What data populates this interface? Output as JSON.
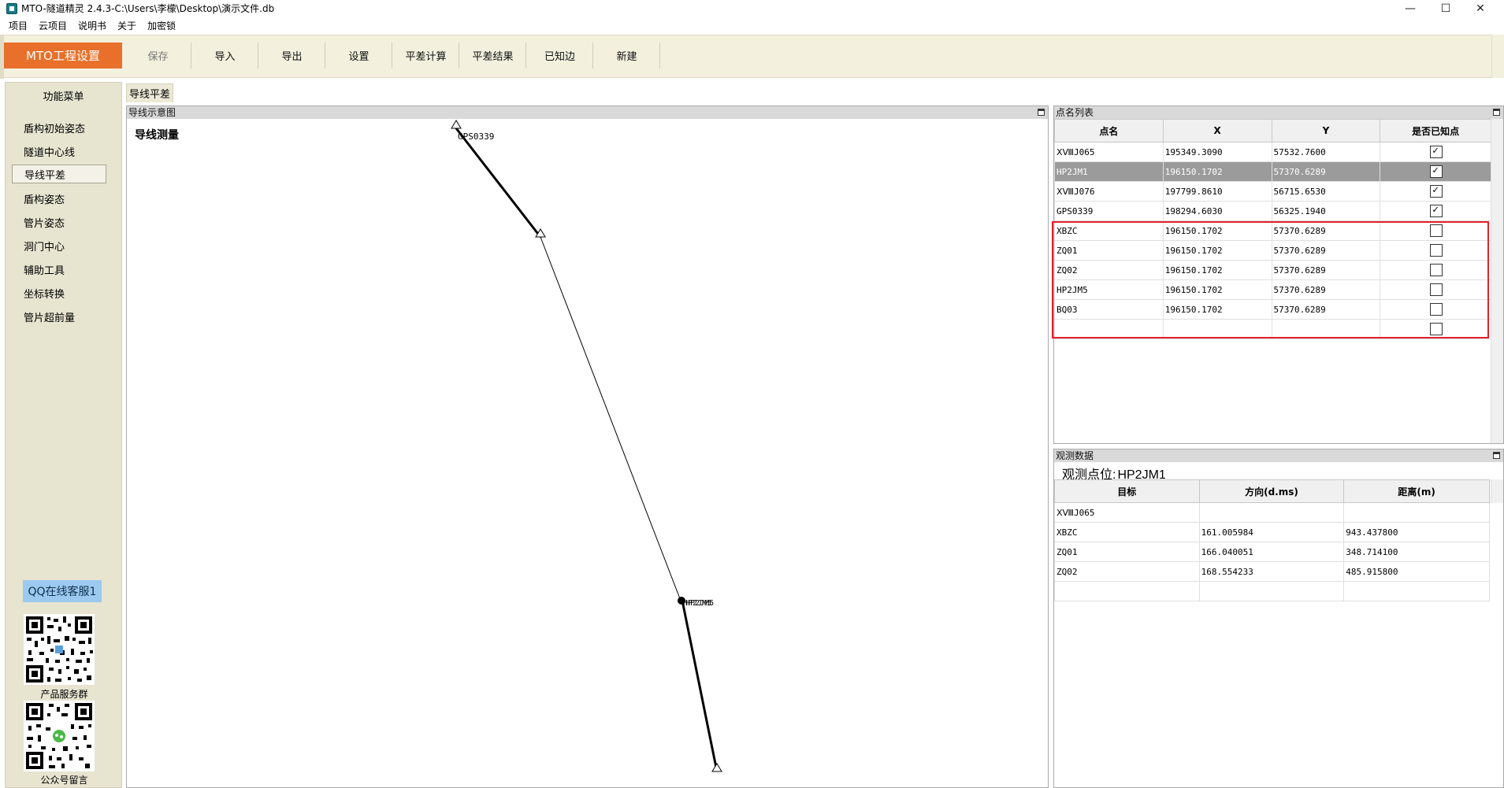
{
  "window": {
    "title": "MTO-隧道精灵 2.4.3-C:\\Users\\李檬\\Desktop\\演示文件.db",
    "min": "—",
    "max": "☐",
    "close": "✕"
  },
  "menu": [
    "项目",
    "云项目",
    "说明书",
    "关于",
    "加密锁"
  ],
  "toolbar": {
    "project_settings": "MTO工程设置",
    "buttons": [
      "保存",
      "导入",
      "导出",
      "设置",
      "平差计算",
      "平差结果",
      "已知边",
      "新建"
    ]
  },
  "sidebar": {
    "title": "功能菜单",
    "items": [
      "盾构初始姿态",
      "隧道中心线",
      "导线平差",
      "盾构姿态",
      "管片姿态",
      "洞门中心",
      "辅助工具",
      "坐标转换",
      "管片超前量"
    ],
    "active_index": 2,
    "qq_service": "QQ在线客服1",
    "qr1_label": "产品服务群",
    "qr2_label": "公众号留言"
  },
  "main_tab": "导线平差",
  "diagram": {
    "panel_title": "导线示意图",
    "heading": "导线测量",
    "point_label_top": "GPS0339",
    "point_label_cluster": "HP2JM5"
  },
  "point_list": {
    "panel_title": "点名列表",
    "columns": [
      "点名",
      "X",
      "Y",
      "是否已知点"
    ],
    "rows": [
      {
        "name": "ⅩⅧJ065",
        "x": "195349.3090",
        "y": "57532.7600",
        "known": true
      },
      {
        "name": "HP2JM1",
        "x": "196150.1702",
        "y": "57370.6289",
        "known": true
      },
      {
        "name": "ⅩⅧJ076",
        "x": "197799.8610",
        "y": "56715.6530",
        "known": true
      },
      {
        "name": "GPS0339",
        "x": "198294.6030",
        "y": "56325.1940",
        "known": true
      },
      {
        "name": "XBZC",
        "x": "196150.1702",
        "y": "57370.6289",
        "known": false
      },
      {
        "name": "ZQ01",
        "x": "196150.1702",
        "y": "57370.6289",
        "known": false
      },
      {
        "name": "ZQ02",
        "x": "196150.1702",
        "y": "57370.6289",
        "known": false
      },
      {
        "name": "HP2JM5",
        "x": "196150.1702",
        "y": "57370.6289",
        "known": false
      },
      {
        "name": "BQ03",
        "x": "196150.1702",
        "y": "57370.6289",
        "known": false
      },
      {
        "name": "",
        "x": "",
        "y": "",
        "known": false
      }
    ],
    "selected_index": 1
  },
  "observation": {
    "panel_title": "观测数据",
    "station_label": "观测点位:",
    "station_value": "HP2JM1",
    "columns": [
      "目标",
      "方向(d.ms)",
      "距离(m)"
    ],
    "rows": [
      {
        "target": "ⅩⅧJ065",
        "direction": "",
        "distance": ""
      },
      {
        "target": "XBZC",
        "direction": "161.005984",
        "distance": "943.437800"
      },
      {
        "target": "ZQ01",
        "direction": "166.040051",
        "distance": "348.714100"
      },
      {
        "target": "ZQ02",
        "direction": "168.554233",
        "distance": "485.915800"
      },
      {
        "target": "",
        "direction": "",
        "distance": ""
      }
    ]
  },
  "colors": {
    "accent": "#e8702a",
    "toolbar_bg": "#f3f0dd",
    "sidebar_bg": "#e7e4d0",
    "selected_row": "#9b9b9b",
    "highlight": "#e4202a",
    "qq_button": "#9cc9ef"
  }
}
